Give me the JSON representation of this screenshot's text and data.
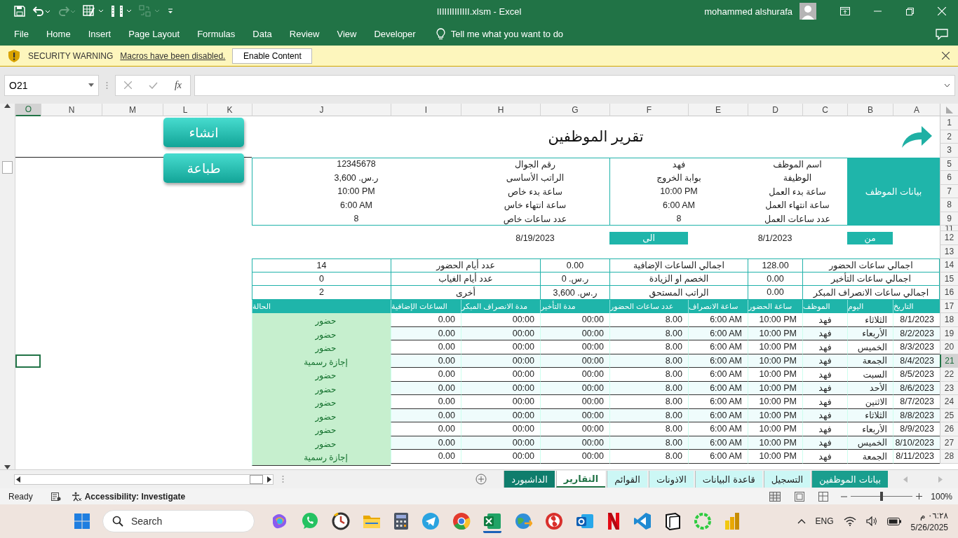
{
  "title_bar": {
    "document_title": "IIIIIIIIIIIII.xlsm  -  Excel",
    "user_name": "mohammed alshurafa"
  },
  "file_menu": "File",
  "ribbon": {
    "home_tab": "Home",
    "insert_tab": "Insert",
    "page_layout_tab": "Page Layout",
    "formulas_tab": "Formulas",
    "data_tab": "Data",
    "review_tab": "Review",
    "view_tab": "View",
    "developer_tab": "Developer"
  },
  "tell_me": "Tell me what you want to do",
  "security_bar": {
    "title": "SECURITY WARNING",
    "message": "Macros have been disabled.",
    "button": "Enable Content"
  },
  "formula_bar": {
    "name_box": "O21",
    "function_label": "fx"
  },
  "columns": [
    {
      "label": "A",
      "selected": false
    },
    {
      "label": "B",
      "selected": false
    },
    {
      "label": "C",
      "selected": false
    },
    {
      "label": "D",
      "selected": false
    },
    {
      "label": "E",
      "selected": false
    },
    {
      "label": "F",
      "selected": false
    },
    {
      "label": "G",
      "selected": false
    },
    {
      "label": "H",
      "selected": false
    },
    {
      "label": "I",
      "selected": false
    },
    {
      "label": "J",
      "selected": false
    },
    {
      "label": "K",
      "selected": false
    },
    {
      "label": "L",
      "selected": false
    },
    {
      "label": "M",
      "selected": false
    },
    {
      "label": "N",
      "selected": false
    },
    {
      "label": "O",
      "selected": true
    }
  ],
  "rows": [
    {
      "label": "1",
      "selected": false
    },
    {
      "label": "2",
      "selected": false
    },
    {
      "label": "3",
      "selected": false
    },
    {
      "label": "5",
      "selected": false
    },
    {
      "label": "6",
      "selected": false
    },
    {
      "label": "7",
      "selected": false
    },
    {
      "label": "8",
      "selected": false
    },
    {
      "label": "9",
      "selected": false
    },
    {
      "label": "11",
      "selected": false
    },
    {
      "label": "12",
      "selected": false
    },
    {
      "label": "13",
      "selected": false
    },
    {
      "label": "14",
      "selected": false
    },
    {
      "label": "15",
      "selected": false
    },
    {
      "label": "16",
      "selected": false
    },
    {
      "label": "17",
      "selected": false
    },
    {
      "label": "18",
      "selected": false
    },
    {
      "label": "19",
      "selected": false
    },
    {
      "label": "20",
      "selected": false
    },
    {
      "label": "21",
      "selected": true
    },
    {
      "label": "22",
      "selected": false
    },
    {
      "label": "23",
      "selected": false
    },
    {
      "label": "24",
      "selected": false
    },
    {
      "label": "25",
      "selected": false
    },
    {
      "label": "26",
      "selected": false
    },
    {
      "label": "27",
      "selected": false
    },
    {
      "label": "28",
      "selected": false
    }
  ],
  "report": {
    "title": "تقرير الموظفين",
    "buttons": [
      "انشاء",
      "طباعة"
    ],
    "employee_section": "بيانات الموظف",
    "employee_rows": [
      [
        "اسم الموظف",
        "فهد",
        "رقم الجوال",
        "12345678"
      ],
      [
        "الوظيفة",
        "بوابة الخروج",
        "الراتب الأساسى",
        "ر.س. 3,600"
      ],
      [
        "ساعة بدء العمل",
        "10:00 PM",
        "ساعة بدء خاص",
        "10:00 PM"
      ],
      [
        "ساعة انتهاء العمل",
        "6:00 AM",
        "ساعة انتهاء خاس",
        "6:00 AM"
      ],
      [
        "عدد ساعات العمل",
        "8",
        "عدد ساعات خاص",
        "8"
      ]
    ],
    "period": {
      "from_label": "من",
      "from": "8/1/2023",
      "to_label": "الى",
      "to": "8/19/2023"
    },
    "summary": [
      [
        "اجمالي ساعات الحضور",
        "128.00",
        "اجمالي الساعات الإضافية",
        "0.00",
        "عدد أيام الحضور",
        "14"
      ],
      [
        "اجمالي ساعات التأخير",
        "0.00",
        "الخصم او الزيادة",
        "ر.س. 0",
        "عدد أيام الغياب",
        "0"
      ],
      [
        "اجمالي ساعات الانصراف المبكر",
        "0.00",
        "الراتب المستحق",
        "ر.س. 3,600",
        "أخرى",
        "2"
      ]
    ],
    "table": {
      "columns": [
        "التاريخ",
        "اليوم",
        "الموظف",
        "ساعة الحضور",
        "ساعة الانصراف",
        "عدد ساعات الحضور",
        "مدة التأخير",
        "مدة الانصراف المبكر",
        "الساعات الإضافية",
        "الحالة"
      ],
      "rows": [
        [
          "8/1/2023",
          "الثلاثاء",
          "فهد",
          "10:00 PM",
          "6:00 AM",
          "8.00",
          "00:00",
          "00:00",
          "0.00",
          "حضور"
        ],
        [
          "8/2/2023",
          "الأربعاء",
          "فهد",
          "10:00 PM",
          "6:00 AM",
          "8.00",
          "00:00",
          "00:00",
          "0.00",
          "حضور"
        ],
        [
          "8/3/2023",
          "الخميس",
          "فهد",
          "10:00 PM",
          "6:00 AM",
          "8.00",
          "00:00",
          "00:00",
          "0.00",
          "حضور"
        ],
        [
          "8/4/2023",
          "الجمعة",
          "فهد",
          "10:00 PM",
          "6:00 AM",
          "8.00",
          "00:00",
          "00:00",
          "0.00",
          "إجازة رسمية"
        ],
        [
          "8/5/2023",
          "السبت",
          "فهد",
          "10:00 PM",
          "6:00 AM",
          "8.00",
          "00:00",
          "00:00",
          "0.00",
          "حضور"
        ],
        [
          "8/6/2023",
          "الأحد",
          "فهد",
          "10:00 PM",
          "6:00 AM",
          "8.00",
          "00:00",
          "00:00",
          "0.00",
          "حضور"
        ],
        [
          "8/7/2023",
          "الاثنين",
          "فهد",
          "10:00 PM",
          "6:00 AM",
          "8.00",
          "00:00",
          "00:00",
          "0.00",
          "حضور"
        ],
        [
          "8/8/2023",
          "الثلاثاء",
          "فهد",
          "10:00 PM",
          "6:00 AM",
          "8.00",
          "00:00",
          "00:00",
          "0.00",
          "حضور"
        ],
        [
          "8/9/2023",
          "الأربعاء",
          "فهد",
          "10:00 PM",
          "6:00 AM",
          "8.00",
          "00:00",
          "00:00",
          "0.00",
          "حضور"
        ],
        [
          "8/10/2023",
          "الخميس",
          "فهد",
          "10:00 PM",
          "6:00 AM",
          "8.00",
          "00:00",
          "00:00",
          "0.00",
          "حضور"
        ],
        [
          "8/11/2023",
          "الجمعة",
          "فهد",
          "10:00 PM",
          "6:00 AM",
          "8.00",
          "00:00",
          "00:00",
          "0.00",
          "إجازة رسمية"
        ]
      ]
    }
  },
  "sheet_tabs": [
    {
      "label": "بيانات الموظفين",
      "selected": false,
      "color": "#1a9e8e"
    },
    {
      "label": "التسجيل",
      "selected": false,
      "color": "#ccf7f5"
    },
    {
      "label": "قاعدة البيانات",
      "selected": false,
      "color": "#ccf7f5"
    },
    {
      "label": "الاذونات",
      "selected": false,
      "color": "#ccf7f5"
    },
    {
      "label": "القوائم",
      "selected": false,
      "color": "#ccf7f5"
    },
    {
      "label": "التقارير",
      "selected": true,
      "color": "#217346"
    },
    {
      "label": "الداشبورد",
      "selected": false,
      "color": "#0f7d6c"
    }
  ],
  "status_bar": {
    "mode": "Ready",
    "accessibility": "Accessibility: Investigate",
    "zoom": "100%",
    "zoom_slider": {
      "level": 0.5
    }
  },
  "taskbar": {
    "search": {
      "placeholder": "Search"
    },
    "language": "ENG",
    "time": "٠٦:٢٨ م",
    "date": "5/26/2025"
  }
}
